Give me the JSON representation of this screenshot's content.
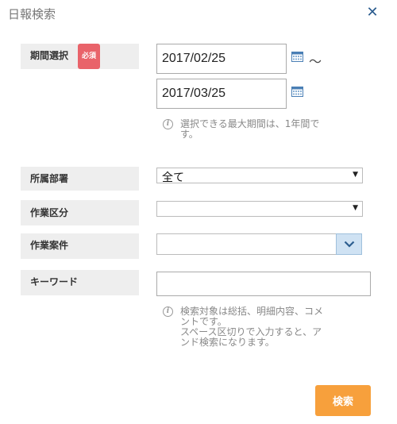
{
  "dialog": {
    "title": "日報検索",
    "close_icon": "close-icon"
  },
  "period": {
    "label": "期間選択",
    "required_badge": "必須",
    "start_date": "2017/02/25",
    "end_date": "2017/03/25",
    "separator": "～",
    "info": [
      "選択できる最大期間は、1年間で",
      "す。"
    ]
  },
  "department": {
    "label": "所属部署",
    "selected": "全て"
  },
  "work_category": {
    "label": "作業区分",
    "selected": ""
  },
  "work_project": {
    "label": "作業案件",
    "value": ""
  },
  "keyword": {
    "label": "キーワード",
    "value": "",
    "info": [
      "検索対象は総括、明細内容、コメ",
      "ントです。",
      "スペース区切りで入力すると、ア",
      "ンド検索になります。"
    ]
  },
  "search_button": {
    "label": "検索"
  },
  "colors": {
    "badge": "#e9636a",
    "button": "#f7a03c",
    "close": "#2c5d8f",
    "combo_button": "#cfe2f3"
  }
}
